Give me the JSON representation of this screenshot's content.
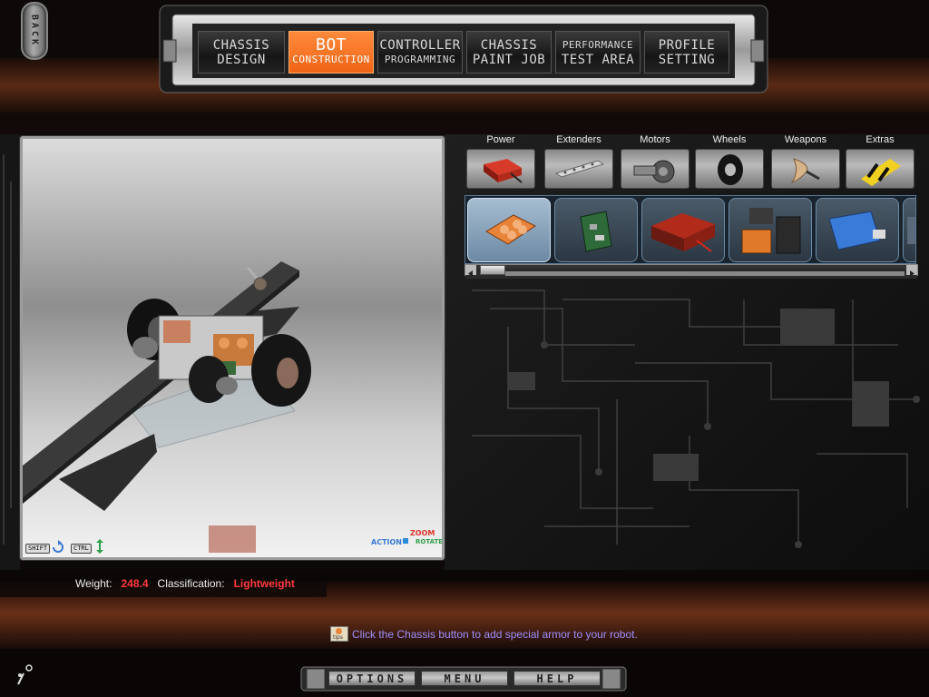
{
  "back": {
    "label": "BACK"
  },
  "nav": [
    {
      "line1": "CHASSIS",
      "line2": "DESIGN",
      "active": false
    },
    {
      "line1": "BOT",
      "line2": "CONSTRUCTION",
      "active": true
    },
    {
      "line1": "CONTROLLER",
      "line2": "PROGRAMMING",
      "active": false
    },
    {
      "line1": "CHASSIS",
      "line2": "PAINT JOB",
      "active": false
    },
    {
      "line1": "PERFORMANCE",
      "line2": "TEST AREA",
      "active": false
    },
    {
      "line1": "PROFILE",
      "line2": "SETTING",
      "active": false
    }
  ],
  "categories": [
    "Power",
    "Extenders",
    "Motors",
    "Wheels",
    "Weapons",
    "Extras"
  ],
  "viewport_controls": {
    "shift": "SHIFT",
    "ctrl": "CTRL",
    "action": "ACTION",
    "zoom": "ZOOM",
    "rotate": "ROTATE"
  },
  "status": {
    "weight_label": "Weight:",
    "weight_value": "248.4",
    "class_label": "Classification:",
    "class_value": "Lightweight"
  },
  "hint": {
    "icon_text": "tips",
    "text": "Click the Chassis button to add special armor to your robot."
  },
  "parts": [
    {
      "icon": "battery-pack-icon",
      "selected": true
    },
    {
      "icon": "circuit-board-icon",
      "selected": false
    },
    {
      "icon": "red-battery-icon",
      "selected": false
    },
    {
      "icon": "dual-battery-icon",
      "selected": false
    },
    {
      "icon": "puma-canister-icon",
      "selected": false
    },
    {
      "icon": "partial-part-icon",
      "selected": false
    }
  ],
  "bottom_menu": {
    "options": "OPTIONS",
    "menu": "MENU",
    "help": "HELP"
  },
  "colors": {
    "accent": "#f06414",
    "status_red": "#ff3a3a",
    "hint": "#9f8fff"
  }
}
